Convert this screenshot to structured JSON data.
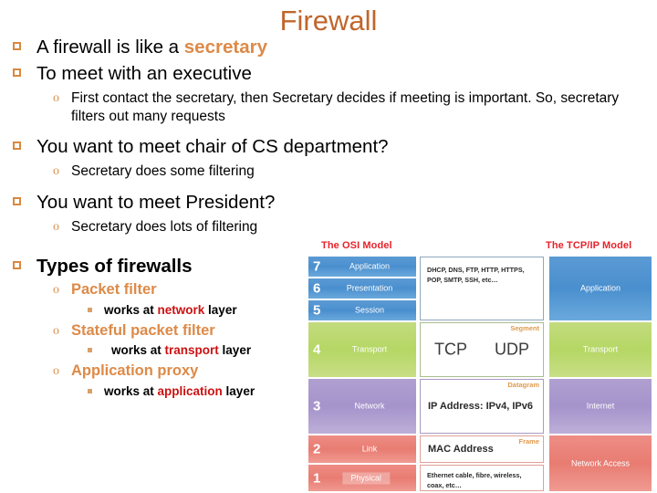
{
  "slide": {
    "title": "Firewall"
  },
  "bullets": [
    {
      "level": 1,
      "bold": false,
      "parts": [
        {
          "text": "A firewall is like a ",
          "style": "plain"
        },
        {
          "text": "secretary",
          "style": "accent-bold"
        }
      ],
      "text": "A firewall is like a secretary"
    },
    {
      "level": 1,
      "bold": false,
      "text": "To meet with an executive"
    },
    {
      "level": 2,
      "text": "First contact the secretary, then Secretary decides if meeting is important. So, secretary filters out many requests"
    },
    {
      "level": 1,
      "bold": false,
      "text": "You want to meet chair of CS department?"
    },
    {
      "level": 2,
      "text": "Secretary does some filtering"
    },
    {
      "level": 1,
      "bold": false,
      "text": "You want to meet President?"
    },
    {
      "level": 2,
      "text": "Secretary does lots of filtering"
    },
    {
      "level": 1,
      "bold": true,
      "text": "Types of firewalls"
    },
    {
      "level": 2,
      "accent": true,
      "text": "Packet filter"
    },
    {
      "level": 3,
      "pre": "works at ",
      "highlight": "network",
      "post": " layer"
    },
    {
      "level": 2,
      "accent": true,
      "text": "Stateful packet filter"
    },
    {
      "level": 3,
      "pre": "works at ",
      "highlight": "transport",
      "post": " layer"
    },
    {
      "level": 2,
      "accent": true,
      "text": "Application proxy"
    },
    {
      "level": 3,
      "pre": "works at ",
      "highlight": "application",
      "post": " layer"
    }
  ],
  "diagram": {
    "osi_header": "The OSI Model",
    "tcpip_header": "The TCP/IP Model",
    "osi_layers": [
      {
        "num": "7",
        "name": "Application",
        "color": "#4A8FCE",
        "group": "blue"
      },
      {
        "num": "6",
        "name": "Presentation",
        "color": "#4A8FCE",
        "group": "blue"
      },
      {
        "num": "5",
        "name": "Session",
        "color": "#4A8FCE",
        "group": "blue"
      },
      {
        "num": "4",
        "name": "Transport",
        "color": "#B5D765",
        "group": "green"
      },
      {
        "num": "3",
        "name": "Network",
        "color": "#A593CB",
        "group": "purple"
      },
      {
        "num": "2",
        "name": "Link",
        "color": "#E87C72",
        "group": "red"
      },
      {
        "num": "1",
        "name": "Physical",
        "color": "#E87C72",
        "group": "red"
      }
    ],
    "protocol_boxes": [
      {
        "tag": "",
        "text": "DHCP, DNS, FTP, HTTP, HTTPS, POP, SMTP, SSH, etc…",
        "kind": "small"
      },
      {
        "tag": "Segment",
        "left": "TCP",
        "right": "UDP",
        "kind": "two-up"
      },
      {
        "tag": "Datagram",
        "text": "IP Address: IPv4, IPv6",
        "kind": "mid"
      },
      {
        "tag": "Frame",
        "text": "MAC Address",
        "kind": "mid"
      },
      {
        "tag": "",
        "text": "Ethernet cable, fibre, wireless, coax, etc…",
        "kind": "small"
      }
    ],
    "tcpip_layers": [
      {
        "name": "Application",
        "color": "#4A8FCE"
      },
      {
        "name": "Transport",
        "color": "#B5D765"
      },
      {
        "name": "Internet",
        "color": "#A593CB"
      },
      {
        "name": "Network Access",
        "color": "#E87C72"
      }
    ],
    "colors": {
      "header_red": "#E8222A",
      "tag_orange": "#E09A4D",
      "blue": "#4A8FCE",
      "green": "#B5D765",
      "purple": "#A593CB",
      "red": "#E87C72"
    }
  },
  "theme": {
    "title_color": "#C0662B",
    "bullet_marker_color": "#D8893F",
    "accent_orange": "#DD8A47",
    "highlight_red": "#CC1111"
  }
}
